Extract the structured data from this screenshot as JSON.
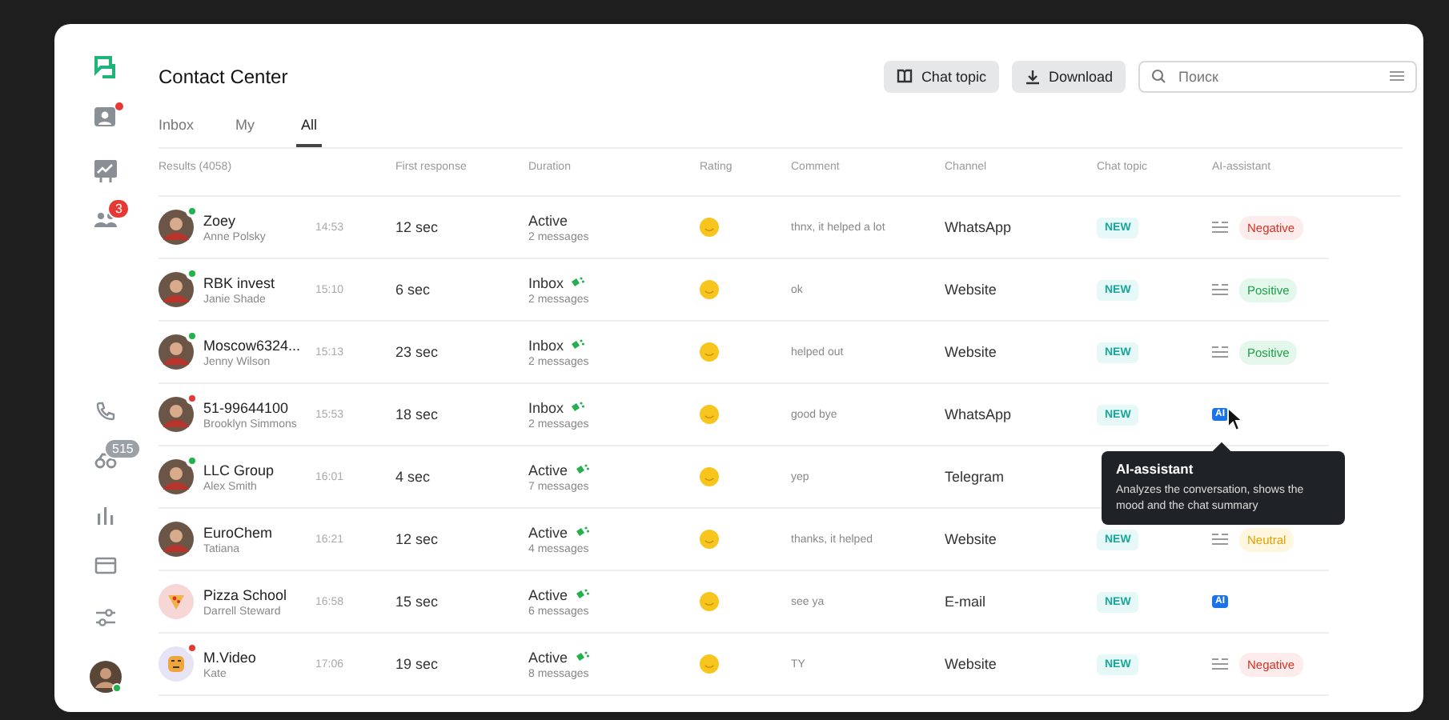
{
  "sidebar": {
    "items": [
      {
        "selected": true
      },
      {
        "selected": false,
        "dot": true
      },
      {
        "selected": false
      },
      {
        "selected": false,
        "badge": "3"
      },
      {
        "selected": false
      },
      {
        "selected": false,
        "badge": "515"
      },
      {
        "selected": false
      },
      {
        "selected": false
      },
      {
        "selected": false
      }
    ]
  },
  "header": {
    "title": "Contact Center",
    "buttons": [
      {
        "label": "Chat topic"
      },
      {
        "label": "Download"
      }
    ],
    "search": {
      "placeholder": "Поиск"
    }
  },
  "tabs": [
    {
      "label": "Inbox",
      "selected": false
    },
    {
      "label": "My",
      "selected": false
    },
    {
      "label": "All",
      "selected": true
    }
  ],
  "table": {
    "columns": [
      "Results (4058)",
      "First response",
      "Duration",
      "Rating",
      "Comment",
      "Channel",
      "Chat topic",
      "AI-assistant"
    ],
    "rows": [
      {
        "color": "#22b14c",
        "name": "Zoey",
        "contact": "Anne Polsky",
        "time": "14:53",
        "first_response": "12 sec",
        "status": "Active",
        "messages": "2 messages",
        "typing": false,
        "comment": "thnx, it helped a lot",
        "channel": "WhatsApp",
        "topic": "NEW",
        "ai": {
          "kind": "summary",
          "sentiment": "Negative"
        }
      },
      {
        "color": "#22b14c",
        "name": "RBK invest",
        "contact": "Janie Shade",
        "time": "15:10",
        "first_response": "6 sec",
        "status": "Inbox",
        "messages": "2 messages",
        "typing": true,
        "comment": "ok",
        "channel": "Website",
        "topic": "NEW",
        "ai": {
          "kind": "summary",
          "sentiment": "Positive"
        }
      },
      {
        "color": "#22b14c",
        "name": "Moscow6324...",
        "contact": "Jenny Wilson",
        "time": "15:13",
        "first_response": "23 sec",
        "status": "Inbox",
        "messages": "2 messages",
        "typing": true,
        "comment": "helped out",
        "channel": "Website",
        "topic": "NEW",
        "ai": {
          "kind": "summary",
          "sentiment": "Positive"
        }
      },
      {
        "color": "#e53935",
        "name": "51-99644100",
        "contact": "Brooklyn Simmons",
        "time": "15:53",
        "first_response": "18 sec",
        "status": "Inbox",
        "messages": "2 messages",
        "typing": true,
        "comment": "good bye",
        "channel": "WhatsApp",
        "topic": "NEW",
        "ai": {
          "kind": "ai",
          "label": "AI"
        }
      },
      {
        "color": "#22b14c",
        "name": "LLC Group",
        "contact": "Alex Smith",
        "time": "16:01",
        "first_response": "4 sec",
        "status": "Active",
        "messages": "7 messages",
        "typing": true,
        "comment": "yep",
        "channel": "Telegram"
      },
      {
        "name": "EuroChem",
        "contact": "Tatiana",
        "time": "16:21",
        "first_response": "12 sec",
        "status": "Active",
        "messages": "4 messages",
        "typing": true,
        "comment": "thanks, it helped",
        "channel": "Website",
        "topic": "NEW",
        "ai": {
          "kind": "summary",
          "sentiment": "Neutral"
        }
      },
      {
        "name": "Pizza School",
        "contact": "Darrell Steward",
        "time": "16:58",
        "first_response": "15 sec",
        "status": "Active",
        "messages": "6 messages",
        "typing": true,
        "comment": "see ya",
        "channel": "E-mail",
        "topic": "NEW",
        "ai": {
          "kind": "ai",
          "label": "AI"
        }
      },
      {
        "color": "#e53935",
        "name": "M.Video",
        "contact": "Kate",
        "time": "17:06",
        "first_response": "19 sec",
        "status": "Active",
        "messages": "8 messages",
        "typing": true,
        "comment": "TY",
        "channel": "Website",
        "topic": "NEW",
        "ai": {
          "kind": "summary",
          "sentiment": "Negative"
        }
      }
    ]
  },
  "tooltip": {
    "title": "AI-assistant",
    "text": "Analyzes the conversation, shows the mood and the chat summary"
  }
}
